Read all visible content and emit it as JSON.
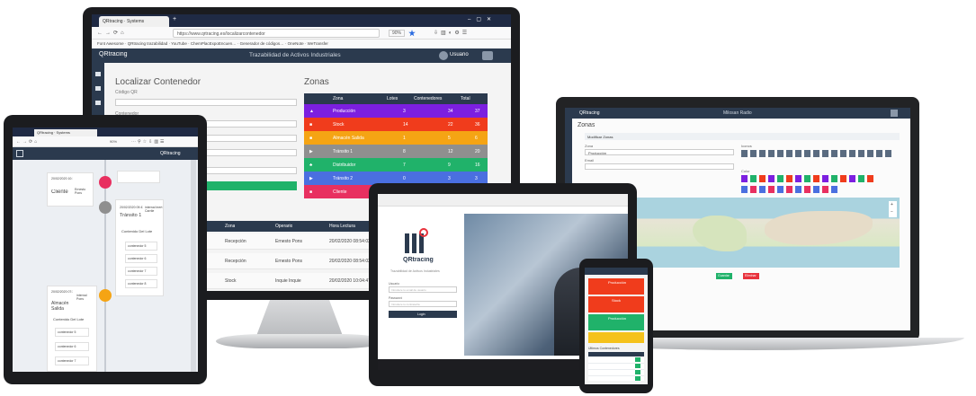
{
  "monitor": {
    "browser_tab": "QRtracing · Systems",
    "url": "https://www.qrtracing.es/localizarcontenedor",
    "zoom": "90%",
    "bookmarks": [
      "Font Awesome",
      "QRtracing trazabilidad",
      "YouTube",
      "ChemPlacExpoEncuen…",
      "Generador de códigos…",
      "OneNote",
      "WeTransfer"
    ],
    "app_logo": "QRtracing",
    "app_title": "Trazabilidad de Activos Industriales",
    "user": "Usuario",
    "left_title": "Localizar Contenedor",
    "code_label": "Código QR",
    "container_label": "Contenedor",
    "locate_button": "Localizar Contenedor",
    "zones_title": "Zonas",
    "zones_headers": [
      "Zona",
      "Lotes",
      "Contenedores",
      "Total"
    ],
    "zones": [
      {
        "name": "Producción",
        "lotes": "3",
        "cont": "34",
        "total": "37",
        "color": "#7c1fe0"
      },
      {
        "name": "Stock",
        "lotes": "14",
        "cont": "22",
        "total": "36",
        "color": "#f03c1c"
      },
      {
        "name": "Almacén Salida",
        "lotes": "1",
        "cont": "5",
        "total": "6",
        "color": "#f5a414"
      },
      {
        "name": "Tránsito 1",
        "lotes": "8",
        "cont": "12",
        "total": "20",
        "color": "#8f8f8f"
      },
      {
        "name": "Distribuidor",
        "lotes": "7",
        "cont": "9",
        "total": "16",
        "color": "#20b26a"
      },
      {
        "name": "Tránsito 2",
        "lotes": "0",
        "cont": "3",
        "total": "3",
        "color": "#4a6fe0"
      },
      {
        "name": "Cliente",
        "lotes": "2",
        "cont": "1",
        "total": "3",
        "color": "#e83060"
      }
    ],
    "history_headers": [
      "Zona",
      "Operario",
      "Hora Lectura"
    ],
    "history_rows": [
      {
        "zona": "Recepción",
        "op": "Ernesto Pons",
        "hora": "20/02/2020 08:54:02"
      },
      {
        "zona": "Recepción",
        "op": "Ernesto Pons",
        "hora": "20/02/2020 08:54:02"
      },
      {
        "zona": "Stock",
        "op": "Inquie Inquie",
        "hora": "20/02/2020 10:04:47"
      }
    ]
  },
  "tablet": {
    "browser_tab": "QRtracing · Systems",
    "zoom": "90%",
    "app_logo": "QRtracing",
    "cards": [
      {
        "date": "20/02/2020 10:19:19",
        "zone": "Cliente",
        "user": "Ernesto Pons"
      },
      {
        "date": "20/02/2020 09:41:44",
        "zone": "Tránsito 1",
        "user": "internal Inert Carrile"
      },
      {
        "date": "20/02/2020 07:34:19",
        "zone": "Almacén Salida",
        "user": "internal Pons"
      }
    ],
    "content_label": "Contenido Del Lote",
    "content_items": [
      "contenedor 5",
      "contenedor 6",
      "contenedor 7",
      "contenedor 8"
    ],
    "content_items_2": [
      "contenedor 5",
      "contenedor 6",
      "contenedor 7"
    ]
  },
  "laptop": {
    "app_logo": "QRtracing",
    "app_title": "Milosan Radio",
    "page_title": "Zonas",
    "section_title": "Modificar Zonas",
    "field_name": "Zona",
    "field_name_value": "Producción",
    "field_email": "Email",
    "icons_label": "Iconos",
    "colors_label": "Color",
    "save_button": "Guardar",
    "delete_button": "Eliminar"
  },
  "small_tablet": {
    "logo": "QRtracing",
    "tagline": "Trazabilidad de Activos Industriales",
    "user_label": "Usuario",
    "user_placeholder": "Introduce tu email de usuario",
    "pass_label": "Password",
    "pass_placeholder": "Introduce tu contraseña",
    "login_button": "Login"
  },
  "phone": {
    "zones": [
      {
        "name": "Producción",
        "color": "#f03c1c"
      },
      {
        "name": "Stock",
        "color": "#f03c1c"
      },
      {
        "name": "Producción",
        "color": "#20b26a"
      },
      {
        "name": "",
        "color": "#f5c21c"
      }
    ],
    "table_label": "Últimos Contenedores"
  }
}
